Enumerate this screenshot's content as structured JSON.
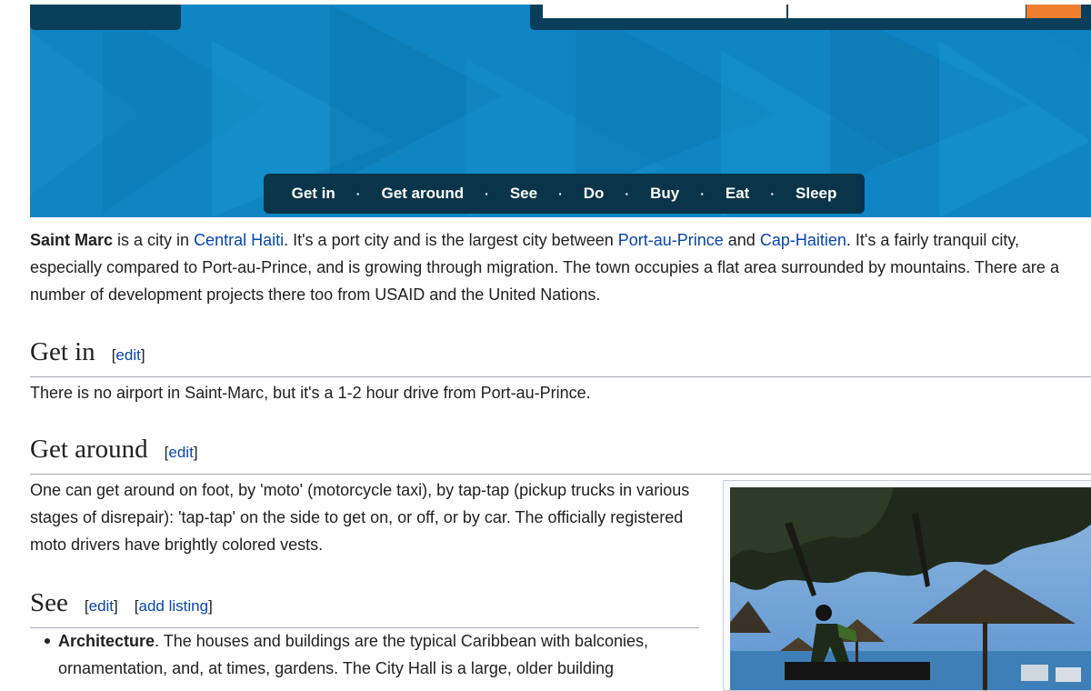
{
  "header": {
    "search_placeholder": "",
    "search_placeholder_2": "",
    "nav_items": [
      "Get in",
      "Get around",
      "See",
      "Do",
      "Buy",
      "Eat",
      "Sleep"
    ],
    "nav_separator": "·"
  },
  "intro": {
    "bold": "Saint Marc",
    "t1": " is a city in ",
    "link1": "Central Haiti",
    "t2": ". It's a port city and is the largest city between ",
    "link2": "Port-au-Prince",
    "t3": " and ",
    "link3": "Cap-Haitien",
    "t4": ". It's a fairly tranquil city, especially compared to Port-au-Prince, and is growing through migration. The town occupies a flat area surrounded by mountains. There are a number of development projects there too from USAID and the United Nations."
  },
  "sections": {
    "get_in": {
      "title": "Get in",
      "edit": "edit",
      "text": "There is no airport in Saint-Marc, but it's a 1-2 hour drive from Port-au-Prince."
    },
    "get_around": {
      "title": "Get around",
      "edit": "edit",
      "text": "One can get around on foot, by 'moto' (motorcycle taxi), by tap-tap (pickup trucks in various stages of disrepair): 'tap-tap' on the side to get on, or off, or by car. The officially registered moto drivers have brightly colored vests."
    },
    "see": {
      "title": "See",
      "edit": "edit",
      "add_listing": "add listing",
      "items": [
        {
          "bold": "Architecture",
          "text": ". The houses and buildings are the typical Caribbean with balconies, ornamentation, and, at times, gardens. The City Hall is a large, older building"
        }
      ]
    }
  },
  "colors": {
    "banner": "#0f86c3",
    "nav_bg": "#0a3449",
    "link": "#0645ad",
    "search_button": "#ef7f2f"
  }
}
